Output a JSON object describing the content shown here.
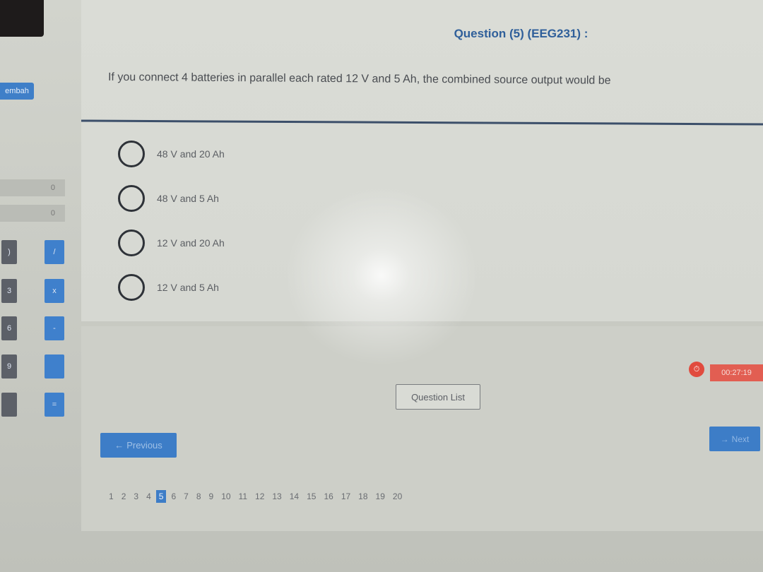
{
  "question": {
    "header": "Question (5) (EEG231) :",
    "text": "If you connect 4 batteries in parallel each rated 12 V and 5 Ah, the combined source output would be",
    "options": [
      {
        "label": "48 V and 20 Ah",
        "selected": false
      },
      {
        "label": "48 V and 5 Ah",
        "selected": false
      },
      {
        "label": "12 V and 20 Ah",
        "selected": false
      },
      {
        "label": "12 V and 5 Ah",
        "selected": false
      }
    ]
  },
  "sidebar": {
    "tab_label": "embah",
    "counters": [
      "0",
      "0"
    ],
    "keypad": {
      "grey": [
        ")",
        "3",
        "6",
        "9",
        ""
      ],
      "blue": [
        "/",
        "x",
        "-",
        "",
        "="
      ]
    }
  },
  "timer": {
    "value": "00:27:19",
    "icon": "alarm-clock-icon",
    "color": "#e25e52"
  },
  "nav": {
    "question_list": "Question List",
    "previous": "Previous",
    "next": "Next",
    "arrow_left": "←",
    "arrow_right": "→"
  },
  "pagination": {
    "pages": [
      "1",
      "2",
      "3",
      "4",
      "5",
      "6",
      "7",
      "8",
      "9",
      "10",
      "11",
      "12",
      "13",
      "14",
      "15",
      "16",
      "17",
      "18",
      "19",
      "20"
    ],
    "current": "5"
  },
  "colors": {
    "accent": "#3d7dc7",
    "header": "#2f5f9a"
  }
}
